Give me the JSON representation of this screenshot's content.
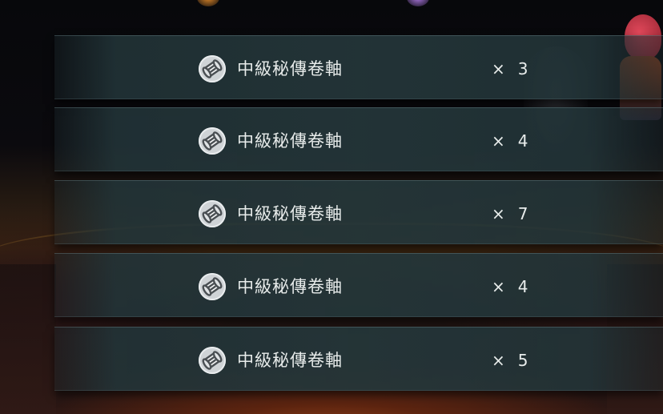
{
  "rewards": [
    {
      "name": "中級秘傳卷軸",
      "multiplier": "×",
      "count": "3",
      "icon": "scroll-icon"
    },
    {
      "name": "中級秘傳卷軸",
      "multiplier": "×",
      "count": "4",
      "icon": "scroll-icon"
    },
    {
      "name": "中級秘傳卷軸",
      "multiplier": "×",
      "count": "7",
      "icon": "scroll-icon"
    },
    {
      "name": "中級秘傳卷軸",
      "multiplier": "×",
      "count": "4",
      "icon": "scroll-icon"
    },
    {
      "name": "中級秘傳卷軸",
      "multiplier": "×",
      "count": "5",
      "icon": "scroll-icon"
    }
  ],
  "colors": {
    "row_background": "#243a3e",
    "text": "#e8eceb",
    "icon_background": "#cfd3d6",
    "icon_glyph": "#4a4f53"
  }
}
